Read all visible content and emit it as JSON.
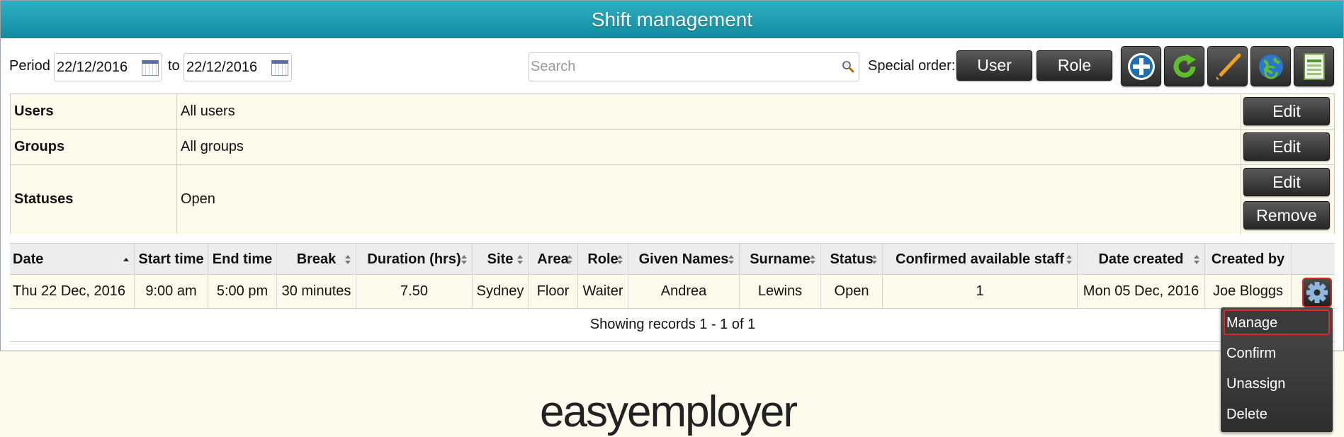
{
  "title": "Shift management",
  "toolbar": {
    "period_label": "Period",
    "date_from": "22/12/2016",
    "to_label": "to",
    "date_to": "22/12/2016",
    "search_placeholder": "Search",
    "special_order_label": "Special order:",
    "user_button": "User",
    "role_button": "Role",
    "icon_buttons": [
      "add-icon",
      "refresh-icon",
      "pencil-icon",
      "globe-icon",
      "spreadsheet-icon"
    ]
  },
  "filters": [
    {
      "name": "Users",
      "value": "All users",
      "buttons": [
        "Edit"
      ]
    },
    {
      "name": "Groups",
      "value": "All groups",
      "buttons": [
        "Edit"
      ]
    },
    {
      "name": "Statuses",
      "value": "Open",
      "buttons": [
        "Edit",
        "Remove"
      ]
    }
  ],
  "table": {
    "columns": [
      "Date",
      "Start time",
      "End time",
      "Break",
      "Duration (hrs)",
      "Site",
      "Area",
      "Role",
      "Given Names",
      "Surname",
      "Status",
      "Confirmed available staff",
      "Date created",
      "Created by"
    ],
    "rows": [
      [
        "Thu 22 Dec, 2016",
        "9:00 am",
        "5:00 pm",
        "30 minutes",
        "7.50",
        "Sydney",
        "Floor",
        "Waiter",
        "Andrea",
        "Lewins",
        "Open",
        "1",
        "Mon 05 Dec, 2016",
        "Joe Bloggs"
      ]
    ],
    "records_text": "Showing records 1 - 1 of 1"
  },
  "action_menu": {
    "items": [
      "Manage",
      "Confirm",
      "Unassign",
      "Delete"
    ],
    "selected": "Manage"
  },
  "logo": {
    "part1": "easy",
    "part2": "employer"
  },
  "colors": {
    "title_bar": "#1a9bb0",
    "row_bg": "#fcfaea",
    "highlight": "#e0262b"
  }
}
